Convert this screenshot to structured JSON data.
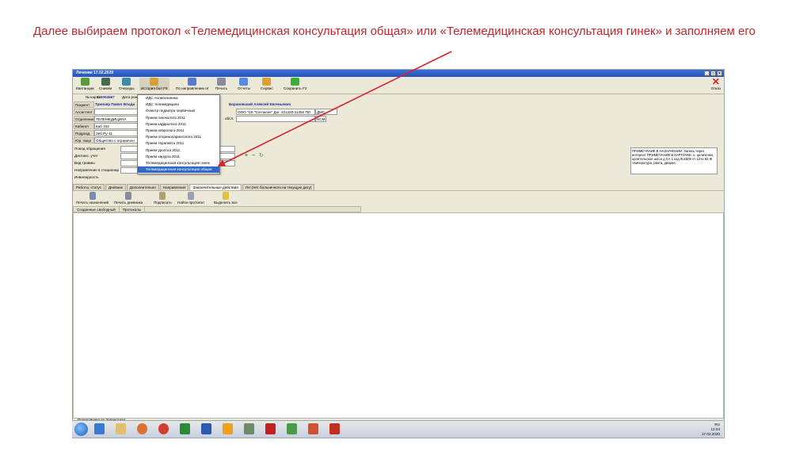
{
  "caption": "Далее выбираем протокол «Телемедицинская консультация общая» или «Телемедицинская консультация гинек» и заполняем его",
  "window": {
    "title": "Лечение 17.02.2020",
    "controls": [
      "_",
      "□",
      "×"
    ]
  },
  "toolbar": [
    {
      "label": "Квитанции",
      "icon": "receipt-icon"
    },
    {
      "label": "Снимки",
      "icon": "camera-icon"
    },
    {
      "label": "Очереды",
      "icon": "queue-icon"
    },
    {
      "label": "История бол F8",
      "icon": "history-icon"
    },
    {
      "label": "По направлению от",
      "icon": "referral-icon"
    },
    {
      "label": "Печать",
      "icon": "print-icon"
    },
    {
      "label": "Отчеты",
      "icon": "reports-icon"
    },
    {
      "label": "Сервис",
      "icon": "service-icon"
    },
    {
      "label": "Сохранить F2",
      "icon": "save-icon"
    }
  ],
  "exit_label": "Отказ",
  "form": {
    "card_label": "№ карты",
    "card_value": "110004567",
    "date_label": "Дата рож",
    "patient_label": "Пациент",
    "patient_value": "Тринчер Павел Влади",
    "doctor_value": "Барановский Алексей Евгеньевич",
    "assistant_label": "Ассистент",
    "department_label": "Отделение",
    "department_value": "ТЕЛЕМЕДИЦИНА",
    "cabinet_label": "Кабинет",
    "cabinet_value": "Каб 102",
    "subdivision_label": "Подразд.",
    "subdivision_value": "Зеб Ру-11",
    "legal_label": "Юр. лицо",
    "legal_value": "Общество с ограничен",
    "contract_value": "ООО \"СК \"Согласие\" Дог. 321220-11382 ПЛ",
    "contract_code": "ДМС",
    "obs_label": "обсл.",
    "nsm_code": "НСМ",
    "reason_label": "Повод обращения",
    "dispensary_label": "Диспанс. учет",
    "injury_label": "Вид травмы",
    "hospital_label": "Направление в стационар",
    "disability_label": "Инвалидность"
  },
  "note_text": "ПРИМЕЧАНИЕ В НАЗНАЧЕНИИ: Запись через интернет ПРИМЕЧАНИЕ В КАРТОЧКЕ: н. целиченко, целительское шеса д 3 п 1 код 0о1509 от 12-ю 82.Ж температура, рвота, диарея.",
  "dropdown": {
    "items": [
      "ИДС полисклиника",
      "ИДС телемедицина",
      "Осмотр педиатра первичный",
      "Прием гинеколога 2011",
      "Прием кардиолога 2011",
      "Прием невролога 2011",
      "Прием оториноларинголога 2011",
      "Прием терапевта 2011",
      "Прием уролога 2011",
      "Прием хирурга 2011",
      "Телемедицинская консультация гинек",
      "Телемедицинская консультация общая"
    ],
    "selected_index": 11
  },
  "tabs": [
    "Работы, статус",
    "Дневник",
    "Дополнительно",
    "Направления",
    "Заключительные действия",
    "ЛН (Нет больничного на текущую дату)"
  ],
  "active_tab": 4,
  "toolbar2": [
    {
      "label": "Печать назначений",
      "icon": "print-assign-icon"
    },
    {
      "label": "Печать дневника",
      "icon": "print-diary-icon"
    },
    {
      "label": "Подписать",
      "icon": "sign-icon"
    },
    {
      "label": "Найти протокол",
      "icon": "find-icon"
    },
    {
      "label": "Выделить все",
      "icon": "select-all-icon"
    }
  ],
  "subtabs": [
    "Созданные свободный",
    "Протоколы"
  ],
  "status_text": "Поликлиника.ру Зеленоград",
  "tray": {
    "lang": "RU",
    "time": "12:04",
    "date": "17.02.2020"
  },
  "colors": {
    "caption": "#c0272d",
    "arrow": "#d9232a",
    "selection": "#316ac5"
  }
}
